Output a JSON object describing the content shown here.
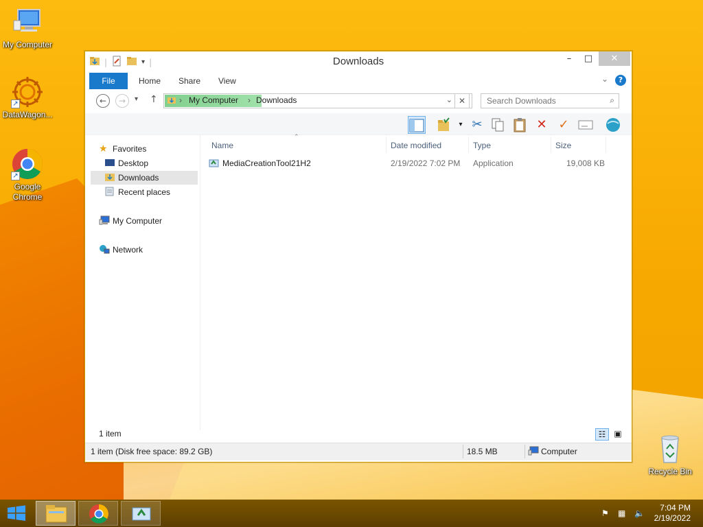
{
  "desktop": {
    "icons": [
      {
        "label": "My Computer",
        "icon": "computer-icon"
      },
      {
        "label": "DataWagon...",
        "icon": "datawagon-icon"
      },
      {
        "label": "Google Chrome",
        "icon": "chrome-icon"
      },
      {
        "label": "Recycle Bin",
        "icon": "recycle-bin-icon"
      }
    ]
  },
  "window": {
    "title": "Downloads",
    "controls": {
      "minimize": "–",
      "maximize": "□",
      "close": "✕"
    },
    "ribbon_tabs": [
      "File",
      "Home",
      "Share",
      "View"
    ],
    "help": "?",
    "address": {
      "crumbs": [
        "My Computer",
        "Downloads"
      ]
    },
    "search": {
      "placeholder": "Search Downloads"
    },
    "nav_pane": {
      "favorites": "Favorites",
      "favorites_items": [
        "Desktop",
        "Downloads",
        "Recent places"
      ],
      "computer": "My Computer",
      "network": "Network"
    },
    "columns": [
      "Name",
      "Date modified",
      "Type",
      "Size"
    ],
    "files": [
      {
        "name": "MediaCreationTool21H2",
        "date": "2/19/2022 7:02 PM",
        "type": "Application",
        "size": "19,008 KB"
      }
    ],
    "item_count": "1 item",
    "status": {
      "left": "1 item (Disk free space: 89.2 GB)",
      "size": "18.5 MB",
      "location": "Computer"
    }
  },
  "taskbar": {
    "clock_time": "7:04 PM",
    "clock_date": "2/19/2022"
  }
}
